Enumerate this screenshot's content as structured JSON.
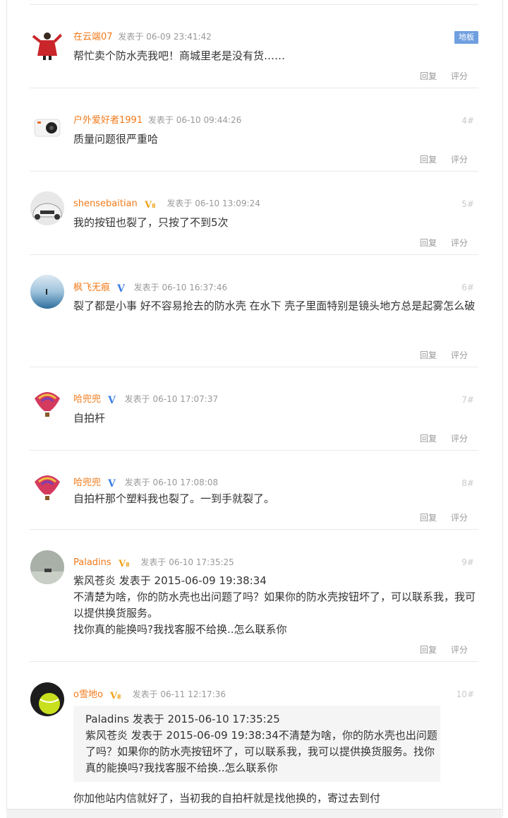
{
  "meta_prefix": "发表于",
  "reply_label": "回复",
  "rate_label": "评分",
  "posts": [
    {
      "author": "在云端07",
      "time": "06-09 23:41:42",
      "floor": "地板",
      "content": "帮忙卖个防水壳我吧！商城里老是没有货……"
    },
    {
      "author": "户外爱好者1991",
      "time": "06-10 09:44:26",
      "floor": "4#",
      "content": "质量问题很严重哈"
    },
    {
      "author": "shensebaitian",
      "time": "06-10 13:09:24",
      "floor": "5#",
      "content": "我的按钮也裂了，只按了不到5次"
    },
    {
      "author": "枫飞无痕",
      "time": "06-10 16:37:46",
      "floor": "6#",
      "content": "裂了都是小事 好不容易抢去的防水壳 在水下 壳子里面特别是镜头地方总是起雾怎么破"
    },
    {
      "author": "哈兜兜",
      "time": "06-10 17:07:37",
      "floor": "7#",
      "content": "自拍杆"
    },
    {
      "author": "哈兜兜",
      "time": "06-10 17:08:08",
      "floor": "8#",
      "content": "自拍杆那个塑料我也裂了。一到手就裂了。"
    },
    {
      "author": "Paladins",
      "time": "06-10 17:35:25",
      "floor": "9#",
      "content_lines": [
        "紫风苍炎 发表于 2015-06-09 19:38:34",
        "不清楚为啥，你的防水壳也出问题了吗？如果你的防水壳按钮坏了，可以联系我，我可以提供换货服务。",
        "找你真的能换吗?我找客服不给换..怎么联系你"
      ]
    },
    {
      "author": "o雪地o",
      "time": "06-11 12:17:36",
      "floor": "10#",
      "quote_header": "Paladins 发表于 2015-06-10 17:35:25",
      "quote_body": "紫风苍炎 发表于 2015-06-09 19:38:34不清楚为啥，你的防水壳也出问题了吗？如果你的防水壳按钮坏了，可以联系我，我可以提供换货服务。找你真的能换吗?我找客服不给换..怎么联系你",
      "content": "你加他站内信就好了，当初我的自拍杆就是找他换的，寄过去到付"
    }
  ]
}
